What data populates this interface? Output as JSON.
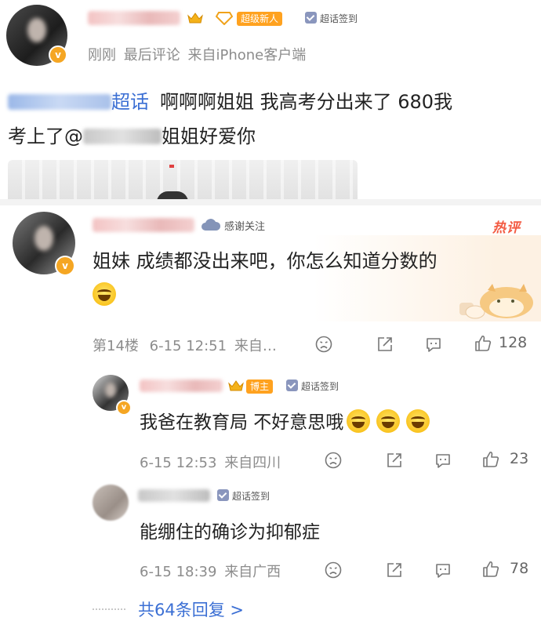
{
  "post": {
    "time_label": "刚刚",
    "last_comment_label": "最后评论",
    "source_label": "来自iPhone客户端",
    "tags": [
      "超级新人",
      "超话签到"
    ],
    "topic_suffix": "超话",
    "body_line1": "啊啊啊姐姐 我高考分出来了 680我",
    "body_line2_prefix": "考上了@",
    "body_line2_suffix": "姐姐好爱你"
  },
  "comment": {
    "follow_label": "感谢关注",
    "hot_label": "热评",
    "text": "姐妹 成绩都没出来吧，你怎么知道分数的",
    "floor": "第14楼",
    "time": "6-15 12:51",
    "source": "来自…",
    "likes": "128"
  },
  "replies": [
    {
      "tags": [
        "博主",
        "超话签到"
      ],
      "text": "我爸在教育局 不好意思哦",
      "time": "6-15 12:53",
      "source": "来自四川",
      "likes": "23"
    },
    {
      "tags": [
        "超话签到"
      ],
      "text": "能绷住的确诊为抑郁症",
      "time": "6-15 18:39",
      "source": "来自广西",
      "likes": "78"
    }
  ],
  "more_replies": "共64条回复 >",
  "colors": {
    "accent_orange": "#ffa21f",
    "link_blue": "#3b6fd4",
    "meta_gray": "#8c8c8c",
    "hot_red": "#f35a42"
  }
}
